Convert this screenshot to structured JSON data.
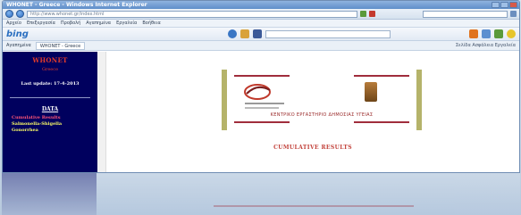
{
  "window": {
    "title": "WHONET - Greece - Windows Internet Explorer"
  },
  "address_bar": {
    "url": "http://www.whonet.gr/index.html"
  },
  "menu": {
    "items": [
      "Αρχείο",
      "Επεξεργασία",
      "Προβολή",
      "Αγαπημένα",
      "Εργαλεία",
      "Βοήθεια"
    ]
  },
  "bing_toolbar": {
    "brand": "bing"
  },
  "favorites_bar": {
    "favorites": "Αγαπημένα",
    "tab": "WHONET - Greece",
    "tools": "Σελίδα  Ασφάλεια  Εργαλεία"
  },
  "sidebar": {
    "title": "WHONET",
    "subtitle": "Greece",
    "last_update": "Last update: 17-4-2013",
    "data_heading": "DATA",
    "links": [
      "Cumulative Results",
      "Salmonella-Shigella",
      "Gonorrhea"
    ]
  },
  "banner": {
    "caption": "ΚΕΝΤΡΙΚΟ ΕΡΓΑΣΤΗΡΙΟ ΔΗΜΟΣΙΑΣ ΥΓΕΙΑΣ"
  },
  "main": {
    "heading": "CUMULATIVE RESULTS"
  },
  "colors": {
    "sidebar_bg": "#00005e",
    "accent_red": "#c2413a",
    "banner_bar": "#b5b36a",
    "link_pink": "#ff5577",
    "link_yellow": "#ffff66"
  }
}
